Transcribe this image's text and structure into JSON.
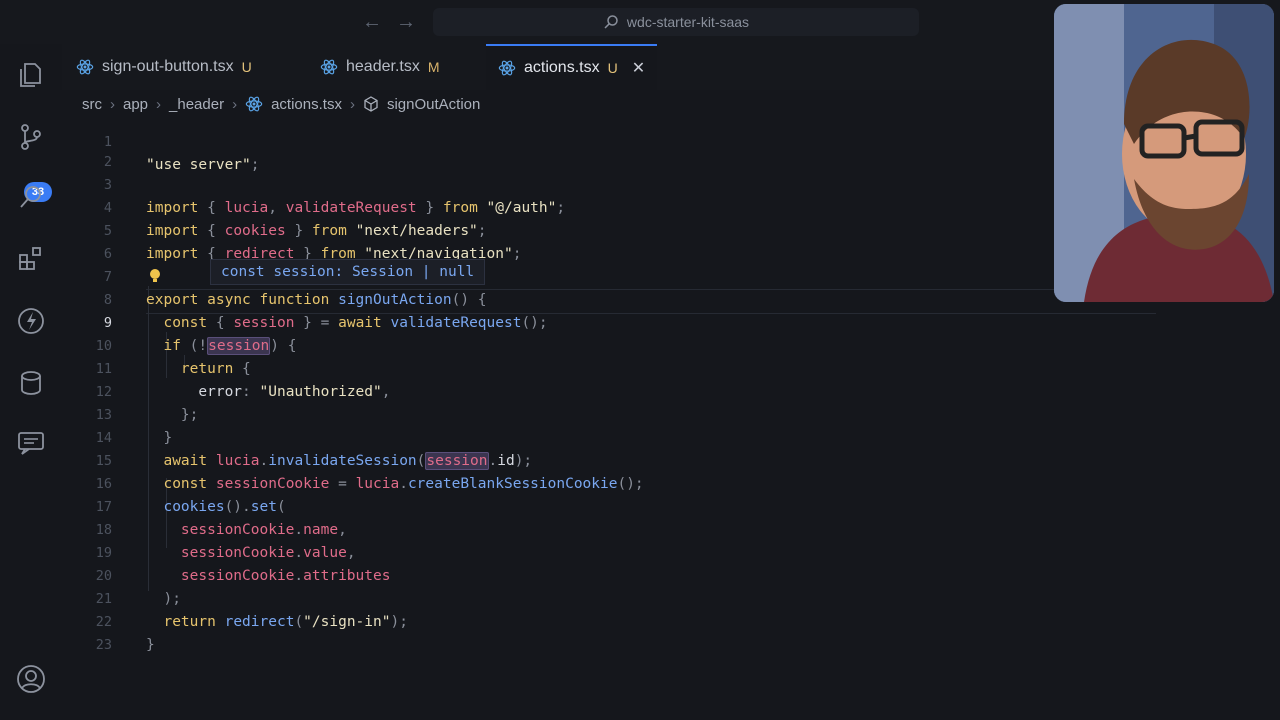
{
  "titlebar": {
    "search_text": "wdc-starter-kit-saas",
    "back_icon": "arrow-left-icon",
    "forward_icon": "arrow-right-icon"
  },
  "activity_bar": {
    "items": [
      {
        "name": "explorer-icon"
      },
      {
        "name": "source-control-icon",
        "badge": "33"
      },
      {
        "name": "search-icon"
      },
      {
        "name": "extensions-icon"
      },
      {
        "name": "lightning-icon"
      },
      {
        "name": "database-icon"
      },
      {
        "name": "chat-icon"
      },
      {
        "name": "account-icon"
      }
    ]
  },
  "tabs": [
    {
      "label": "sign-out-button.tsx",
      "status": "U",
      "active": false
    },
    {
      "label": "header.tsx",
      "status": "M",
      "active": false
    },
    {
      "label": "actions.tsx",
      "status": "U",
      "active": true
    }
  ],
  "breadcrumb": {
    "parts": [
      "src",
      "app",
      "_header",
      "actions.tsx",
      "signOutAction"
    ]
  },
  "editor": {
    "current_line": "9",
    "lines": [
      {
        "n": "1",
        "text": "\"use server\";"
      },
      {
        "n": "2",
        "text": ""
      },
      {
        "n": "3",
        "text": "import { lucia, validateRequest } from \"@/auth\";"
      },
      {
        "n": "4",
        "text": "import { cookies } from \"next/headers\";"
      },
      {
        "n": "5",
        "text": "import { redirect } from \"next/navigation\";"
      },
      {
        "n": "6",
        "text": ""
      },
      {
        "n": "7",
        "text": "export async function signOutAction() {"
      },
      {
        "n": "8",
        "text": "const { session } = await validateRequest();"
      },
      {
        "n": "9",
        "text": "if (!session) {"
      },
      {
        "n": "10",
        "text": "return {"
      },
      {
        "n": "11",
        "text": "error: \"Unauthorized\","
      },
      {
        "n": "12",
        "text": "};"
      },
      {
        "n": "13",
        "text": "}"
      },
      {
        "n": "14",
        "text": "await lucia.invalidateSession(session.id);"
      },
      {
        "n": "15",
        "text": "const sessionCookie = lucia.createBlankSessionCookie();"
      },
      {
        "n": "16",
        "text": "cookies().set("
      },
      {
        "n": "17",
        "text": "sessionCookie.name,"
      },
      {
        "n": "18",
        "text": "sessionCookie.value,"
      },
      {
        "n": "19",
        "text": "sessionCookie.attributes"
      },
      {
        "n": "20",
        "text": ");"
      },
      {
        "n": "21",
        "text": "return redirect(\"/sign-in\");"
      },
      {
        "n": "22",
        "text": "}"
      },
      {
        "n": "23",
        "text": ""
      }
    ]
  },
  "hover_tooltip": {
    "text": "const session: Session | null"
  }
}
